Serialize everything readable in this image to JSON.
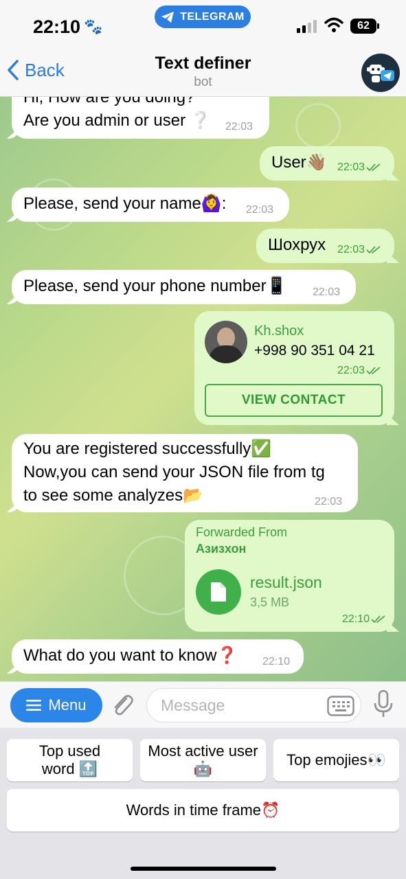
{
  "status": {
    "time": "22:10",
    "battery": "62",
    "telegram_label": "TELEGRAM"
  },
  "header": {
    "back_label": "Back",
    "title": "Text definer",
    "subtitle": "bot"
  },
  "messages": [
    {
      "dir": "in",
      "lines": [
        "Hi, How are you doing?",
        "Are you admin or user ❔"
      ],
      "time": "22:03"
    },
    {
      "dir": "out",
      "text": "User👋🏽",
      "time": "22:03"
    },
    {
      "dir": "in",
      "text": "Please, send your name🙆‍♀️:",
      "time": "22:03"
    },
    {
      "dir": "out",
      "text": "Шохрух",
      "time": "22:03"
    },
    {
      "dir": "in",
      "text": "Please, send your phone number📱",
      "time": "22:03"
    },
    {
      "dir": "out",
      "type": "contact",
      "name": "Kh.shox",
      "phone": "+998 90 351 04 21",
      "time": "22:03",
      "button": "VIEW CONTACT"
    },
    {
      "dir": "in",
      "lines": [
        "You are registered successfully✅",
        "Now,you can send your JSON file from tg",
        "to see some analyzes📂"
      ],
      "time": "22:03"
    },
    {
      "dir": "out",
      "type": "file",
      "forwarded_label": "Forwarded From",
      "forwarded_from": "Азизхон",
      "file_name": "result.json",
      "file_size": "3,5 MB",
      "time": "22:10"
    },
    {
      "dir": "in",
      "text": "What do you want to know❓",
      "time": "22:10"
    }
  ],
  "input": {
    "menu_label": "Menu",
    "placeholder": "Message"
  },
  "keyboard": {
    "buttons": [
      {
        "label_line1": "Top used",
        "label_line2": "word 🔝"
      },
      {
        "label_line1": "Most active user",
        "label_line2": "🤖"
      },
      {
        "label": "Top emojies👀"
      },
      {
        "label": "Words in time frame⏰"
      }
    ]
  },
  "colors": {
    "accent": "#2c86e8",
    "outgoing_bubble": "#e1f9c8",
    "incoming_bubble": "#ffffff",
    "outgoing_meta": "#3aa03a"
  }
}
